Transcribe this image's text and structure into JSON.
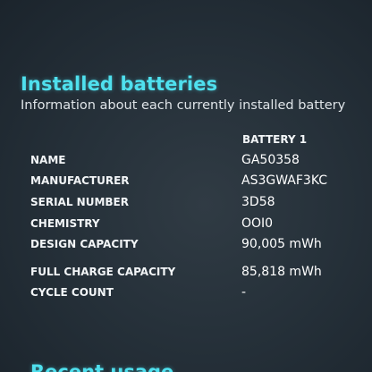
{
  "section": {
    "title": "Installed batteries",
    "subtitle": "Information about each currently installed battery"
  },
  "table": {
    "column_header": "BATTERY 1",
    "rows": [
      {
        "label": "NAME",
        "value": "GA50358"
      },
      {
        "label": "MANUFACTURER",
        "value": "AS3GWAF3KC"
      },
      {
        "label": "SERIAL NUMBER",
        "value": "3D58"
      },
      {
        "label": "CHEMISTRY",
        "value": "OOI0"
      },
      {
        "label": "DESIGN CAPACITY",
        "value": "90,005 mWh"
      },
      {
        "label": "FULL CHARGE CAPACITY",
        "value": "85,818 mWh"
      },
      {
        "label": "CYCLE COUNT",
        "value": "-"
      }
    ]
  },
  "next_section": {
    "title_partial": "Recent usage"
  },
  "colors": {
    "background": "#26313a",
    "heading_accent": "#4fe0ee",
    "text": "#ffffff"
  }
}
